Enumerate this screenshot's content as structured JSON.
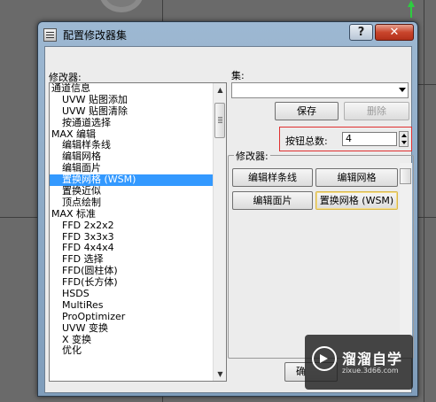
{
  "window": {
    "title": "配置修改器集",
    "help_glyph": "?",
    "close_glyph": "✕"
  },
  "modifiers_panel": {
    "label": "修改器:",
    "items": [
      {
        "text": "通道信息",
        "kind": "group"
      },
      {
        "text": "UVW 贴图添加",
        "kind": "child"
      },
      {
        "text": "UVW 贴图清除",
        "kind": "child"
      },
      {
        "text": "按通道选择",
        "kind": "child"
      },
      {
        "text": "MAX 编辑",
        "kind": "group"
      },
      {
        "text": "编辑样条线",
        "kind": "child"
      },
      {
        "text": "编辑网格",
        "kind": "child"
      },
      {
        "text": "编辑面片",
        "kind": "child"
      },
      {
        "text": "置换网格 (WSM)",
        "kind": "selected"
      },
      {
        "text": "置换近似",
        "kind": "child"
      },
      {
        "text": "顶点绘制",
        "kind": "child"
      },
      {
        "text": "MAX 标准",
        "kind": "group"
      },
      {
        "text": "FFD 2x2x2",
        "kind": "child"
      },
      {
        "text": "FFD 3x3x3",
        "kind": "child"
      },
      {
        "text": "FFD 4x4x4",
        "kind": "child"
      },
      {
        "text": "FFD 选择",
        "kind": "child"
      },
      {
        "text": "FFD(圆柱体)",
        "kind": "child"
      },
      {
        "text": "FFD(长方体)",
        "kind": "child"
      },
      {
        "text": "HSDS",
        "kind": "child"
      },
      {
        "text": "MultiRes",
        "kind": "child"
      },
      {
        "text": "ProOptimizer",
        "kind": "child"
      },
      {
        "text": "UVW 变换",
        "kind": "child"
      },
      {
        "text": "X 变换",
        "kind": "child"
      },
      {
        "text": "优化",
        "kind": "child"
      }
    ]
  },
  "set_panel": {
    "label": "集:",
    "combo_value": "",
    "save_label": "保存",
    "delete_label": "删除",
    "button_count_label": "按钮总数:",
    "button_count_value": "4"
  },
  "modifier_buttons": {
    "group_label": "修改器:",
    "buttons": [
      "编辑样条线",
      "编辑网格",
      "编辑面片",
      "置换网格 (WSM)"
    ]
  },
  "footer": {
    "ok_partial_label": "确"
  },
  "watermark": {
    "title": "溜溜自学",
    "url": "zixue.3d66.com"
  }
}
